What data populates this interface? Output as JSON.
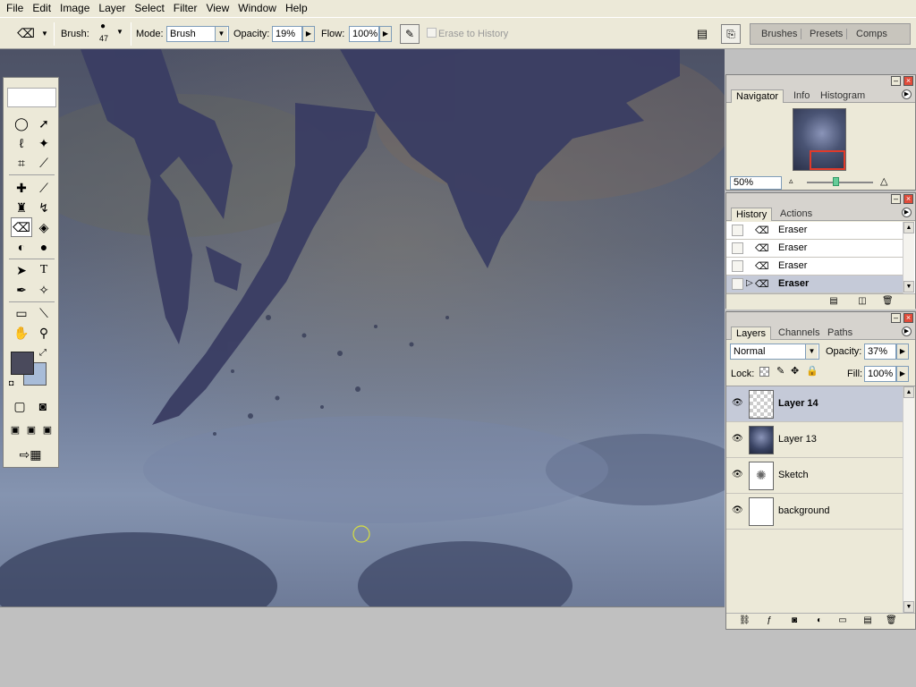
{
  "menubar": {
    "items": [
      "File",
      "Edit",
      "Image",
      "Layer",
      "Select",
      "Filter",
      "View",
      "Window",
      "Help"
    ]
  },
  "options_bar": {
    "brush_label": "Brush:",
    "brush_size": "47",
    "mode_label": "Mode:",
    "mode_value": "Brush",
    "opacity_label": "Opacity:",
    "opacity_value": "19%",
    "flow_label": "Flow:",
    "flow_value": "100%",
    "erase_to_history": "Erase to History",
    "well_tabs": [
      "Brushes",
      "Presets",
      "Comps"
    ]
  },
  "navigator": {
    "tabs": [
      "Navigator",
      "Info",
      "Histogram"
    ],
    "zoom": "50%"
  },
  "history": {
    "tabs": [
      "History",
      "Actions"
    ],
    "items": [
      {
        "label": "Eraser",
        "active": false
      },
      {
        "label": "Eraser",
        "active": false
      },
      {
        "label": "Eraser",
        "active": false
      },
      {
        "label": "Eraser",
        "active": true
      }
    ]
  },
  "layers": {
    "tabs": [
      "Layers",
      "Channels",
      "Paths"
    ],
    "blend_mode": "Normal",
    "opacity_label": "Opacity:",
    "opacity_value": "37%",
    "lock_label": "Lock:",
    "fill_label": "Fill:",
    "fill_value": "100%",
    "items": [
      {
        "name": "Layer 14",
        "active": true
      },
      {
        "name": "Layer 13",
        "active": false
      },
      {
        "name": "Sketch",
        "active": false
      },
      {
        "name": "background",
        "active": false
      }
    ]
  },
  "colors": {
    "foreground": "#4a4a5c",
    "background": "#a8bcd8",
    "accent_close": "#e04b3a",
    "selection": "#c5cad8"
  }
}
